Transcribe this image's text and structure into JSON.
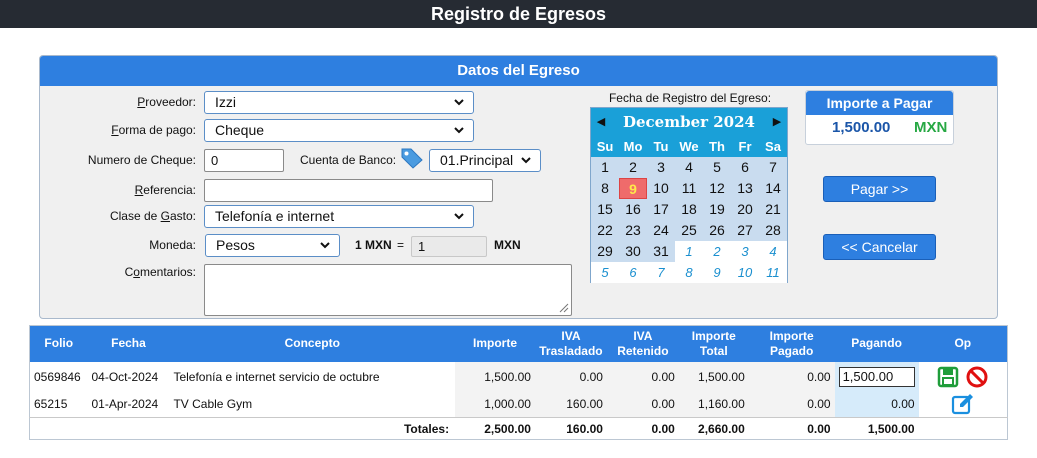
{
  "page_title": "Registro de Egresos",
  "panel": {
    "title": "Datos del Egreso"
  },
  "form": {
    "proveedor_label": "Proveedor:",
    "proveedor_value": "Izzi",
    "forma_pago_label": "Forma de pago:",
    "forma_pago_value": "Cheque",
    "num_cheque_label": "Numero de Cheque:",
    "num_cheque_value": "0",
    "cuenta_banco_label": "Cuenta de Banco:",
    "cuenta_banco_value": "01.Principal",
    "referencia_label": "Referencia:",
    "referencia_value": "",
    "clase_gasto_label": "Clase de Gasto:",
    "clase_gasto_value": "Telefonía e internet",
    "moneda_label": "Moneda:",
    "moneda_value": "Pesos",
    "rate_prefix": "1 MXN",
    "rate_eq": "=",
    "rate_value": "1",
    "rate_suffix": "MXN",
    "comentarios_label": "Comentarios:",
    "comentarios_value": ""
  },
  "calendar": {
    "label": "Fecha de Registro del Egreso:",
    "month_title": "December 2024",
    "prev_glyph": "◀",
    "next_glyph": "▶",
    "weekdays": [
      "Su",
      "Mo",
      "Tu",
      "We",
      "Th",
      "Fr",
      "Sa"
    ],
    "weeks": [
      [
        "1",
        "2",
        "3",
        "4",
        "5",
        "6",
        "7"
      ],
      [
        "8",
        "9",
        "10",
        "11",
        "12",
        "13",
        "14"
      ],
      [
        "15",
        "16",
        "17",
        "18",
        "19",
        "20",
        "21"
      ],
      [
        "22",
        "23",
        "24",
        "25",
        "26",
        "27",
        "28"
      ],
      [
        "29",
        "30",
        "31",
        "1",
        "2",
        "3",
        "4"
      ],
      [
        "5",
        "6",
        "7",
        "8",
        "9",
        "10",
        "11"
      ]
    ],
    "selected_day": "9"
  },
  "importe": {
    "title": "Importe a Pagar",
    "value": "1,500.00",
    "currency": "MXN",
    "value_color": "#1a55a8",
    "currency_color": "#27a844"
  },
  "buttons": {
    "pagar": "Pagar >>",
    "cancelar": "<< Cancelar"
  },
  "table": {
    "headers": {
      "folio": "Folio",
      "fecha": "Fecha",
      "concepto": "Concepto",
      "importe": "Importe",
      "iva_tras_1": "IVA",
      "iva_tras_2": "Trasladado",
      "iva_ret_1": "IVA",
      "iva_ret_2": "Retenido",
      "imp_total_1": "Importe",
      "imp_total_2": "Total",
      "imp_pag_1": "Importe",
      "imp_pag_2": "Pagado",
      "pagando": "Pagando",
      "op": "Op"
    },
    "rows": [
      {
        "folio": "0569846",
        "fecha": "04-Oct-2024",
        "concepto": "Telefonía e internet servicio de octubre",
        "importe": "1,500.00",
        "iva_trasladado": "0.00",
        "iva_retenido": "0.00",
        "importe_total": "1,500.00",
        "importe_pagado": "0.00",
        "pagando": "1,500.00"
      },
      {
        "folio": "65215",
        "fecha": "01-Apr-2024",
        "concepto": "TV Cable Gym",
        "importe": "1,000.00",
        "iva_trasladado": "160.00",
        "iva_retenido": "0.00",
        "importe_total": "1,160.00",
        "importe_pagado": "0.00",
        "pagando": "0.00"
      }
    ],
    "totals": {
      "label": "Totales:",
      "importe": "2,500.00",
      "iva_trasladado": "160.00",
      "iva_retenido": "0.00",
      "importe_total": "2,660.00",
      "importe_pagado": "0.00",
      "pagando": "1,500.00"
    }
  },
  "icons": {
    "save": "save-icon",
    "cancel": "cancel-icon",
    "edit": "edit-icon",
    "tag": "tag-icon"
  },
  "colors": {
    "accent": "#2e7fe0",
    "topbar": "#262b33",
    "calendar_header": "#1aa0d8",
    "today": "#ef6b6b"
  }
}
